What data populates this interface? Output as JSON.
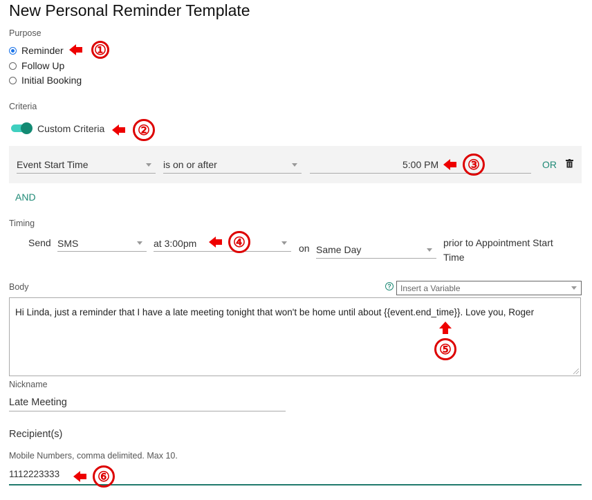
{
  "page": {
    "title": "New Personal Reminder Template"
  },
  "purpose": {
    "label": "Purpose",
    "options": [
      {
        "label": "Reminder",
        "selected": true
      },
      {
        "label": "Follow Up",
        "selected": false
      },
      {
        "label": "Initial Booking",
        "selected": false
      }
    ]
  },
  "criteria": {
    "label": "Criteria",
    "toggle_label": "Custom Criteria",
    "toggle_on": true,
    "rule": {
      "field": "Event Start Time",
      "operator": "is on or after",
      "value": "5:00 PM"
    },
    "or_label": "OR",
    "and_label": "AND"
  },
  "timing": {
    "label": "Timing",
    "send_label": "Send",
    "channel": "SMS",
    "time": "at 3:00pm",
    "on_label": "on",
    "day": "Same Day",
    "suffix": "prior to Appointment Start Time"
  },
  "body": {
    "label": "Body",
    "variable_placeholder": "Insert a Variable",
    "text": "Hi Linda, just a reminder that I have a late meeting tonight that won't be home until about {{event.end_time}}. Love you, Roger"
  },
  "nickname": {
    "label": "Nickname",
    "value": "Late Meeting"
  },
  "recipients": {
    "heading": "Recipient(s)",
    "hint": "Mobile Numbers, comma delimited. Max 10.",
    "value": "1112223333"
  },
  "annotations": [
    "①",
    "②",
    "③",
    "④",
    "⑤",
    "⑥"
  ],
  "colors": {
    "accent": "#1f8a76",
    "toggle_knob": "#138a73",
    "toggle_track": "#3fcfbf",
    "annotation": "#dd0000",
    "radio": "#1a73e8"
  }
}
